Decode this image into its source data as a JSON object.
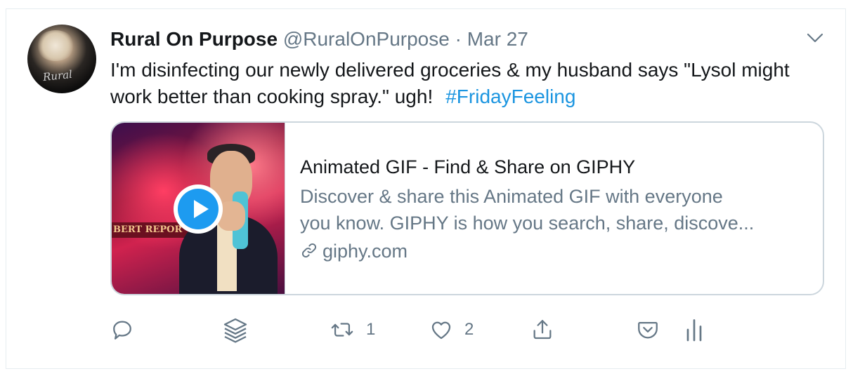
{
  "tweet": {
    "author_name": "Rural On Purpose",
    "handle": "@RuralOnPurpose",
    "separator": "·",
    "date": "Mar 27",
    "text": "I'm disinfecting our newly delivered groceries & my husband says \"Lysol might work better than cooking spray.\" ugh!",
    "hashtag": "#FridayFeeling",
    "avatar_text": "Rural"
  },
  "card": {
    "thumbnail_banner": "BERT REPOR",
    "title": "Animated GIF - Find & Share on GIPHY",
    "description_line1": "Discover & share this Animated GIF with everyone",
    "description_line2": "you know. GIPHY is how you search, share, discove...",
    "link": "giphy.com"
  },
  "actions": {
    "reply_icon": "reply-icon",
    "stack_icon": "stack-icon",
    "retweet_icon": "retweet-icon",
    "retweet_count": "1",
    "like_icon": "heart-icon",
    "like_count": "2",
    "share_icon": "share-icon",
    "pocket_icon": "pocket-icon",
    "analytics_icon": "analytics-icon"
  },
  "colors": {
    "text": "#14171a",
    "muted": "#657786",
    "link": "#1b95e0",
    "border": "#ccd6dd",
    "play": "#1d9bf0"
  }
}
